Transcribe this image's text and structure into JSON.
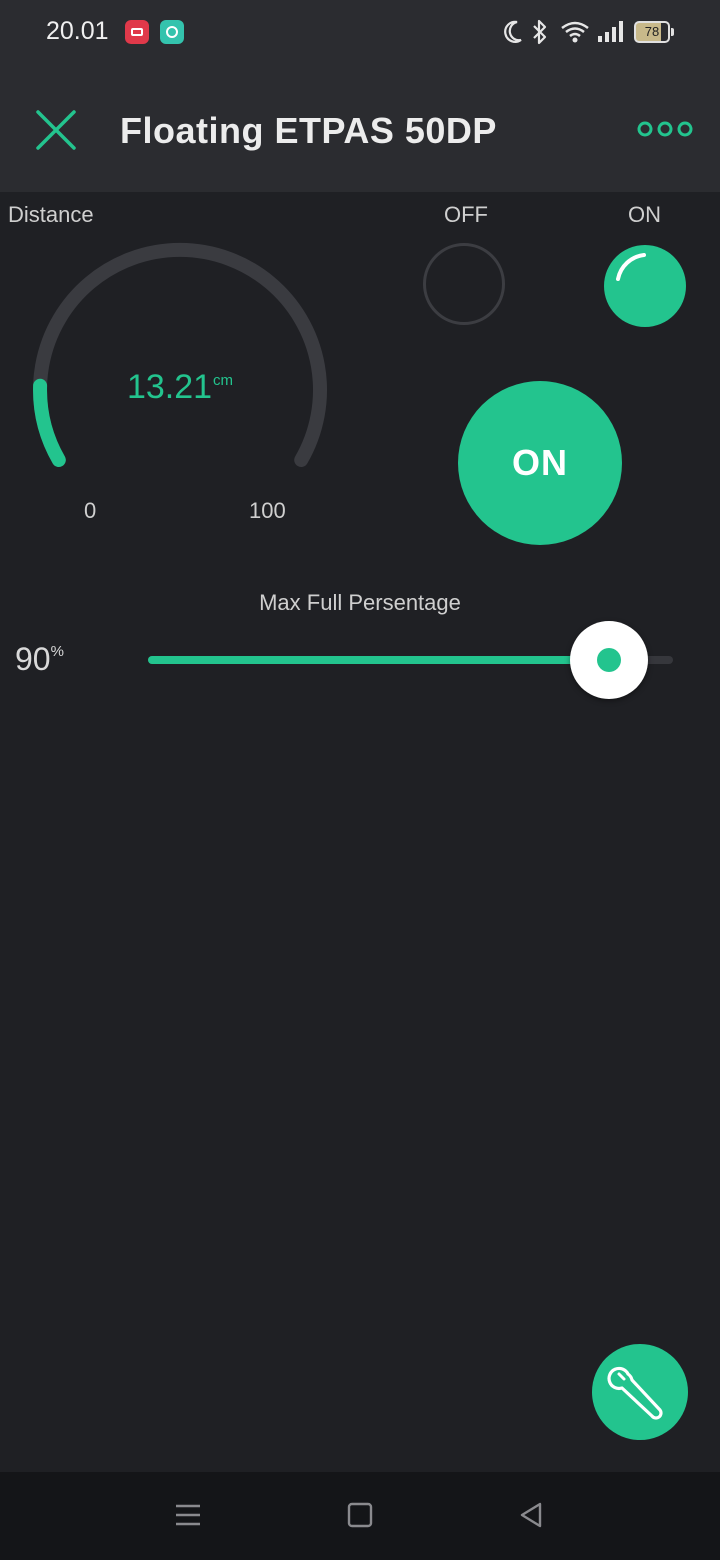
{
  "status_bar": {
    "time": "20.01",
    "battery": "78"
  },
  "header": {
    "title": "Floating ETPAS 50DP"
  },
  "gauge": {
    "label": "Distance",
    "value": "13.21",
    "unit": "cm",
    "min": "0",
    "max": "100",
    "value_num": 13.21,
    "min_num": 0,
    "max_num": 100
  },
  "leds": {
    "off_label": "OFF",
    "on_label": "ON"
  },
  "button": {
    "label": "ON"
  },
  "slider": {
    "title": "Max Full Persentage",
    "value": "90",
    "unit": "%",
    "fraction": 0.9
  },
  "colors": {
    "accent": "#23c48e",
    "background": "#1f2024",
    "header": "#2b2c30"
  },
  "icons": {
    "close": "close-icon",
    "more": "more-horizontal-icon",
    "wrench": "wrench-icon",
    "nav_menu": "menu-icon",
    "nav_home": "home-icon",
    "nav_back": "back-icon"
  }
}
